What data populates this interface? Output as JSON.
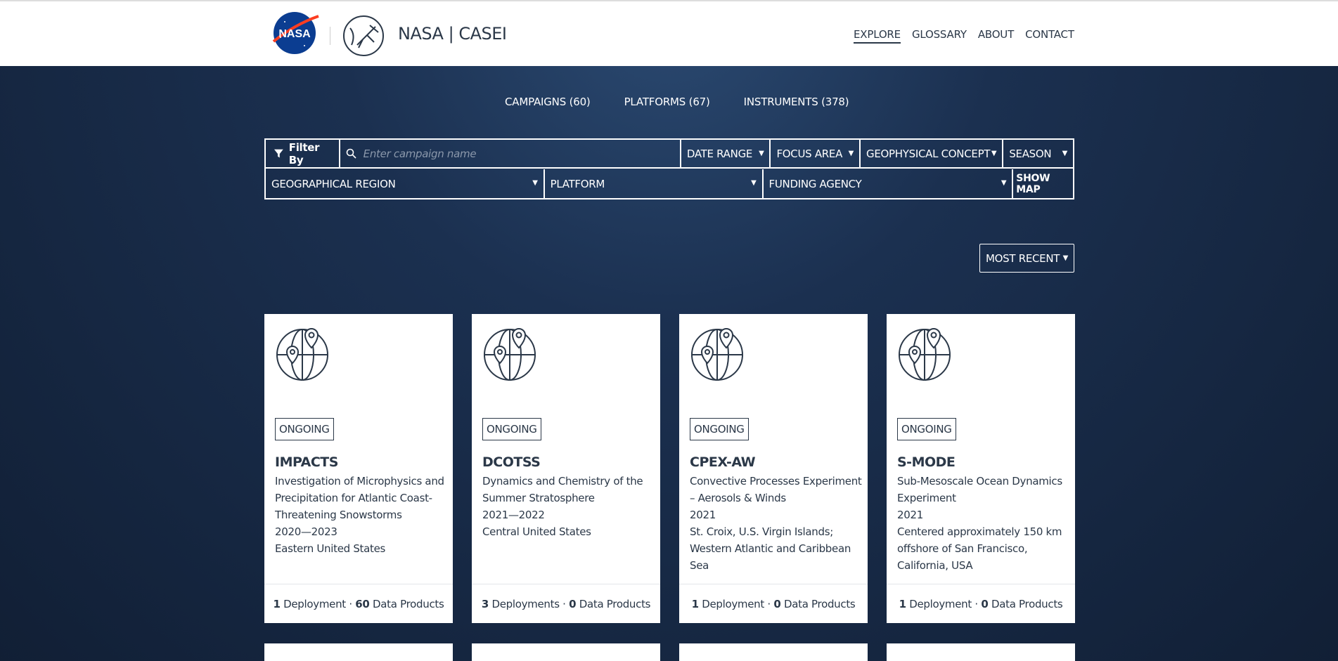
{
  "header": {
    "brand": "NASA | CASEI",
    "nav": [
      {
        "label": "EXPLORE",
        "active": true
      },
      {
        "label": "GLOSSARY"
      },
      {
        "label": "ABOUT"
      },
      {
        "label": "CONTACT"
      }
    ]
  },
  "tabs": [
    "CAMPAIGNS (60)",
    "PLATFORMS (67)",
    "INSTRUMENTS (378)"
  ],
  "filters": {
    "filter_by": "Filter By",
    "search_placeholder": "Enter campaign name",
    "date_range": "DATE RANGE",
    "focus_area": "FOCUS AREA",
    "geophysical_concept": "GEOPHYSICAL CONCEPT",
    "season": "SEASON",
    "geographical_region": "GEOGRAPHICAL REGION",
    "platform": "PLATFORM",
    "funding_agency": "FUNDING AGENCY",
    "show_map": "SHOW MAP"
  },
  "sort": {
    "label": "MOST RECENT"
  },
  "cards": [
    {
      "status": "ONGOING",
      "title": "IMPACTS",
      "description": "Investigation of Microphysics and Precipitation for Atlantic Coast-Threatening Snowstorms",
      "dates": "2020—2023",
      "region": "Eastern United States",
      "deployments_count": "1",
      "deployments_label": "Deployment",
      "products_count": "60",
      "products_label": "Data Products"
    },
    {
      "status": "ONGOING",
      "title": "DCOTSS",
      "description": "Dynamics and Chemistry of the Summer Stratosphere",
      "dates": "2021—2022",
      "region": "Central United States",
      "deployments_count": "3",
      "deployments_label": "Deployments",
      "products_count": "0",
      "products_label": "Data Products"
    },
    {
      "status": "ONGOING",
      "title": "CPEX-AW",
      "description": "Convective Processes Experiment – Aerosols & Winds",
      "dates": "2021",
      "region": "St. Croix, U.S. Virgin Islands; Western Atlantic and Caribbean Sea",
      "deployments_count": "1",
      "deployments_label": "Deployment",
      "products_count": "0",
      "products_label": "Data Products"
    },
    {
      "status": "ONGOING",
      "title": "S-MODE",
      "description": "Sub-Mesoscale Ocean Dynamics Experiment",
      "dates": "2021",
      "region": "Centered approximately 150 km offshore of San Francisco, California, USA",
      "deployments_count": "1",
      "deployments_label": "Deployment",
      "products_count": "0",
      "products_label": "Data Products"
    }
  ],
  "colors": {
    "header_bg": "#ffffff",
    "page_bg": "#1b3050",
    "text_dark": "#2b3848",
    "nasa_blue": "#0b3d91",
    "nasa_red": "#fc3d21"
  }
}
